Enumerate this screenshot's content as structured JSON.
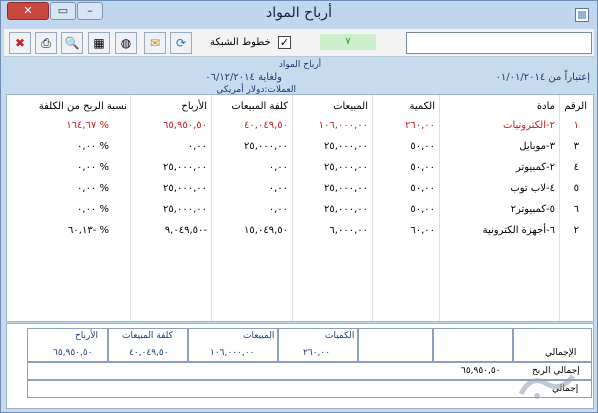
{
  "window": {
    "title": "أرباح المواد"
  },
  "toolbar": {
    "grid_lines_label": "خطوط الشبكة",
    "grid_lines_checked": "✓",
    "counter": "٧",
    "search_value": ""
  },
  "report": {
    "heading": "أرباح المواد",
    "period": "إعتباراً من ٠١/٠١/٢٠١٤",
    "until": "ولغاية ٠٦/١٢/٢٠١٤",
    "currency": "العملات:دولار أمريكي"
  },
  "table": {
    "headers": [
      "الرقم",
      "مادة",
      "الكمية",
      "المبيعات",
      "كلفة المبيعات",
      "الأرباح",
      "نسبة الربح من الكلفة"
    ],
    "rows": [
      {
        "num": "١",
        "item": "٢-الكترونيات",
        "qty": "٢٦٠,٠٠",
        "sales": "١٠٦,٠٠٠,٠٠",
        "cost": "٤٠,٠٤٩,٥٠",
        "profit": "٦٥,٩٥٠,٥٠",
        "pct": "١٦٤,٦٧ %"
      },
      {
        "num": "٣",
        "item": "٣-موبايل",
        "qty": "٥٠,٠٠",
        "sales": "٢٥,٠٠٠,٠٠",
        "cost": "٢٥,٠٠٠,٠٠",
        "profit": "٠,٠٠",
        "pct": "٠,٠٠ %"
      },
      {
        "num": "٤",
        "item": "٢-كمبيوتر",
        "qty": "٥٠,٠٠",
        "sales": "٢٥,٠٠٠,٠٠",
        "cost": "٠,٠٠",
        "profit": "٢٥,٠٠٠,٠٠",
        "pct": "٠,٠٠ %"
      },
      {
        "num": "٥",
        "item": "٤-لاب توب",
        "qty": "٥٠,٠٠",
        "sales": "٢٥,٠٠٠,٠٠",
        "cost": "٠,٠٠",
        "profit": "٢٥,٠٠٠,٠٠",
        "pct": "٠,٠٠ %"
      },
      {
        "num": "٦",
        "item": "٥-كمبيوتر٢",
        "qty": "٥٠,٠٠",
        "sales": "٢٥,٠٠٠,٠٠",
        "cost": "٠,٠٠",
        "profit": "٢٥,٠٠٠,٠٠",
        "pct": "٠,٠٠ %"
      },
      {
        "num": "٢",
        "item": "٦-أجهزة الكترونية",
        "qty": "٦٠,٠٠",
        "sales": "٦,٠٠٠,٠٠",
        "cost": "١٥,٠٤٩,٥٠",
        "profit": "٩,٠٤٩,٥٠-",
        "pct": "٦٠,١٣- %"
      }
    ]
  },
  "footer": {
    "headers": {
      "qty": "الكميات",
      "sales": "المبيعات",
      "cost": "كلفة المبيعات",
      "profit": "الأرباح"
    },
    "total_label": "الإجمالي",
    "total": {
      "qty": "٢٦٠,٠٠",
      "sales": "١٠٦,٠٠٠,٠٠",
      "cost": "٤٠,٠٤٩,٥٠",
      "profit": "٦٥,٩٥٠,٥٠"
    },
    "row2_label": "إجمالي الربح",
    "row2_value": "٦٥,٩٥٠,٥٠",
    "row3_label": "إجمالي"
  },
  "colors": {
    "red": "#c62020",
    "accent": "#1f3b78",
    "title_bg": "#c2d7ee"
  }
}
